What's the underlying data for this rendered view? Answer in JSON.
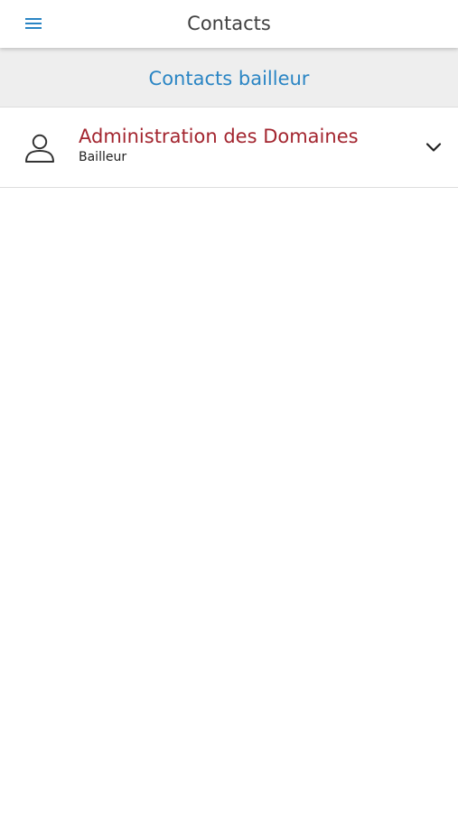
{
  "header": {
    "title": "Contacts",
    "menu_icon": "hamburger-menu-icon"
  },
  "section": {
    "title": "Contacts bailleur"
  },
  "contacts": [
    {
      "name": "Administration des Domaines",
      "role": "Bailleur",
      "avatar_icon": "person-outline-icon",
      "expand_icon": "chevron-down-icon"
    }
  ],
  "colors": {
    "accent_blue": "#2a85c4",
    "name_red": "#a3252f",
    "header_text": "#404040",
    "section_bg": "#eeeeee"
  }
}
